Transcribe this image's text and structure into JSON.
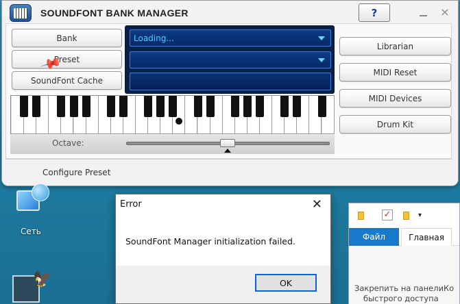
{
  "soundfont": {
    "title": "SOUNDFONT BANK MANAGER",
    "help": "?",
    "close": "×",
    "left_buttons": [
      "Bank",
      "Preset",
      "SoundFont Cache"
    ],
    "right_buttons": [
      "Librarian",
      "MIDI Reset",
      "MIDI Devices",
      "Drum Kit"
    ],
    "dropdown_bank": "Loading...",
    "octave_label": "Octave:",
    "configure_label": "Configure Preset"
  },
  "desktop": {
    "network_label": "Сеть"
  },
  "error_dialog": {
    "title": "Error",
    "close": "✕",
    "message": "SoundFont Manager initialization failed.",
    "ok_label": "OK"
  },
  "explorer": {
    "tab_file": "Файл",
    "tab_home": "Главная",
    "pin_label_line1": "Закрепить на панели",
    "pin_label_line2": "быстрого доступа",
    "more_label": "Ко"
  },
  "colors": {
    "display_bg": "#06204a",
    "dropdown_text": "#3fd2ff",
    "file_tab": "#1979ca",
    "ok_border": "#0a64d6"
  }
}
